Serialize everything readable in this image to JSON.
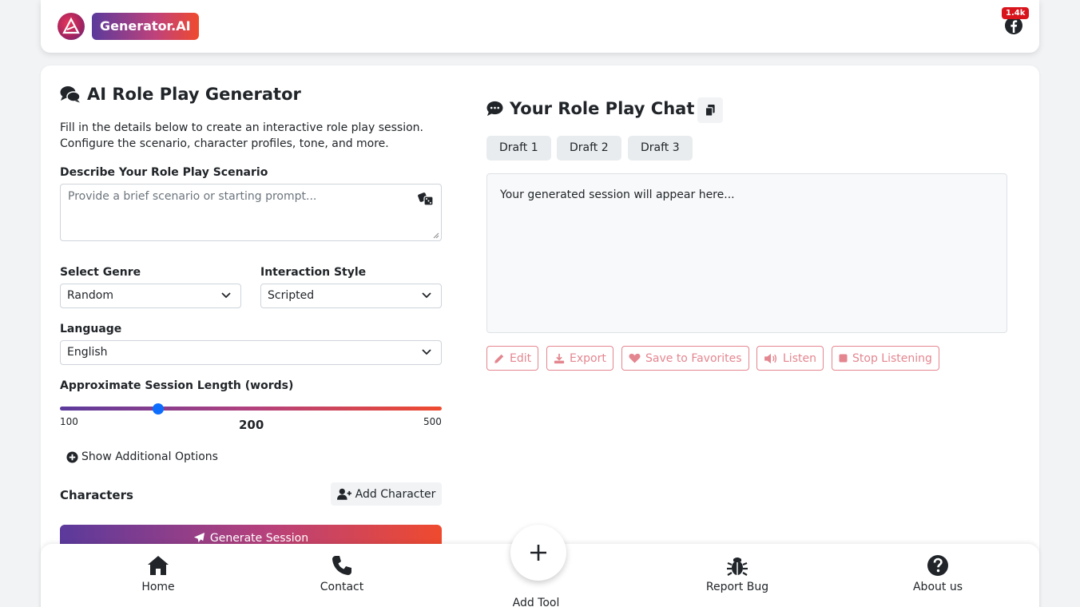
{
  "header": {
    "brand": "Generator.AI",
    "social_count": "1.4k",
    "social_icon": "facebook-icon"
  },
  "form": {
    "title": "AI Role Play Generator",
    "intro": "Fill in the details below to create an interactive role play session. Configure the scenario, character profiles, tone, and more.",
    "scenario_label": "Describe Your Role Play Scenario",
    "scenario_placeholder": "Provide a brief scenario or starting prompt...",
    "genre_label": "Select Genre",
    "genre_value": "Random",
    "style_label": "Interaction Style",
    "style_value": "Scripted",
    "language_label": "Language",
    "language_value": "English",
    "length_label": "Approximate Session Length (words)",
    "length_min": "100",
    "length_value": "200",
    "length_max": "500",
    "additional_options": "Show Additional Options",
    "characters_label": "Characters",
    "add_character": "Add Character",
    "generate": "Generate Session"
  },
  "chat": {
    "title": "Your Role Play Chat",
    "drafts": [
      "Draft 1",
      "Draft 2",
      "Draft 3"
    ],
    "output_placeholder": "Your generated session will appear here...",
    "actions": {
      "edit": "Edit",
      "export": "Export",
      "favorite": "Save to Favorites",
      "listen": "Listen",
      "stop": "Stop Listening"
    }
  },
  "bottom_nav": {
    "home": "Home",
    "contact": "Contact",
    "add_tool": "Add Tool",
    "report_bug": "Report Bug",
    "about": "About us"
  },
  "colors": {
    "gradient_start": "#5b3a9c",
    "gradient_end": "#ef4a2e",
    "action_outline": "#e4868f",
    "slider_thumb": "#0d6efd",
    "badge_red": "#d8151c"
  }
}
